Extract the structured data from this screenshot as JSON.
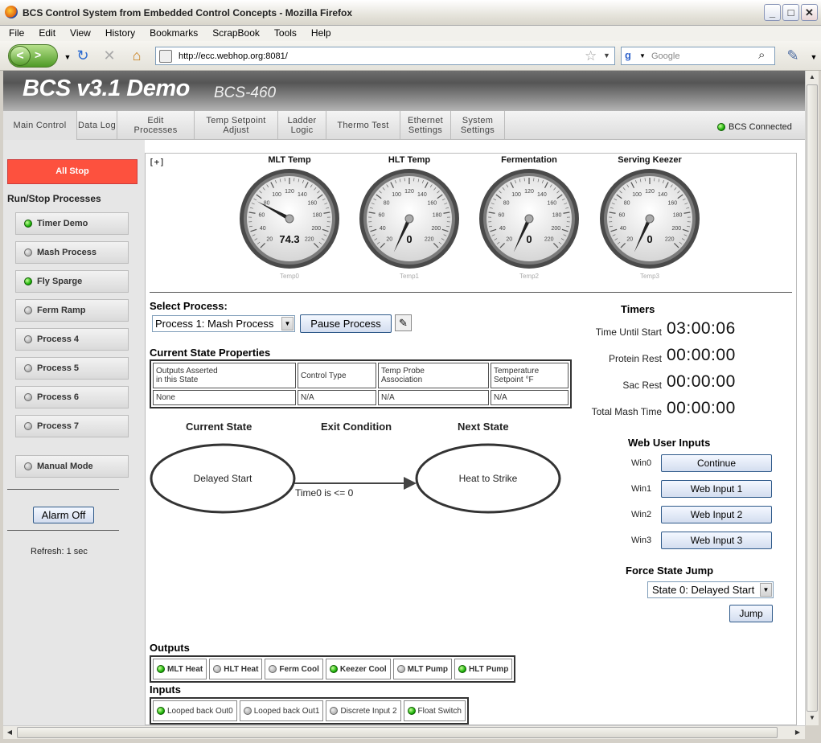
{
  "window": {
    "title": "BCS Control System from Embedded Control Concepts - Mozilla Firefox"
  },
  "menu": [
    "File",
    "Edit",
    "View",
    "History",
    "Bookmarks",
    "ScrapBook",
    "Tools",
    "Help"
  ],
  "browser": {
    "url": "http://ecc.webhop.org:8081/",
    "search_placeholder": "Google"
  },
  "header": {
    "title": "BCS v3.1 Demo",
    "model": "BCS-460"
  },
  "tabs": [
    {
      "label": "Main Control",
      "active": true
    },
    {
      "label": "Data Log"
    },
    {
      "label": "Edit\nProcesses"
    },
    {
      "label": "Temp Setpoint\nAdjust"
    },
    {
      "label": "Ladder\nLogic"
    },
    {
      "label": "Thermo Test"
    },
    {
      "label": "Ethernet\nSettings"
    },
    {
      "label": "System\nSettings"
    }
  ],
  "connection": {
    "label": "BCS Connected",
    "connected": true
  },
  "sidebar": {
    "all_stop": "All Stop",
    "run_stop_title": "Run/Stop Processes",
    "processes": [
      {
        "label": "Timer Demo",
        "on": true
      },
      {
        "label": "Mash Process",
        "on": false
      },
      {
        "label": "Fly Sparge",
        "on": true
      },
      {
        "label": "Ferm Ramp",
        "on": false
      },
      {
        "label": "Process 4",
        "on": false
      },
      {
        "label": "Process 5",
        "on": false
      },
      {
        "label": "Process 6",
        "on": false
      },
      {
        "label": "Process 7",
        "on": false
      }
    ],
    "manual_mode": {
      "label": "Manual Mode",
      "on": false
    },
    "alarm_off": "Alarm Off",
    "refresh": "Refresh: 1 sec"
  },
  "main": {
    "expand": "[+]",
    "gauges": [
      {
        "title": "MLT Temp",
        "value": 74.3,
        "display": "74.3",
        "sub": "Temp0"
      },
      {
        "title": "HLT Temp",
        "value": 0,
        "display": "0",
        "sub": "Temp1"
      },
      {
        "title": "Fermentation",
        "value": 0,
        "display": "0",
        "sub": "Temp2"
      },
      {
        "title": "Serving Keezer",
        "value": 0,
        "display": "0",
        "sub": "Temp3"
      }
    ],
    "gauge_scale": {
      "min": 20,
      "max": 220,
      "ticks": [
        "20",
        "40",
        "60",
        "80",
        "100",
        "120",
        "140",
        "160",
        "180",
        "200",
        "220"
      ]
    },
    "select_process_title": "Select Process:",
    "selected_process": "Process 1: Mash Process",
    "pause_button": "Pause Process",
    "current_state_title": "Current State Properties",
    "state_table": {
      "headers": [
        "Outputs Asserted\nin this State",
        "Control Type",
        "Temp Probe\nAssociation",
        "Temperature\nSetpoint °F"
      ],
      "row": [
        "None",
        "N/A",
        "N/A",
        "N/A"
      ]
    },
    "diagram": {
      "current_state_label": "Current State",
      "exit_condition_label": "Exit Condition",
      "next_state_label": "Next State",
      "current_state": "Delayed Start",
      "exit_condition": "Time0 is <= 0",
      "next_state": "Heat to Strike"
    },
    "timers_title": "Timers",
    "timers": [
      {
        "label": "Time Until Start",
        "value": "03:00:06"
      },
      {
        "label": "Protein Rest",
        "value": "00:00:00"
      },
      {
        "label": "Sac Rest",
        "value": "00:00:00"
      },
      {
        "label": "Total Mash Time",
        "value": "00:00:00"
      }
    ],
    "web_inputs_title": "Web User Inputs",
    "web_inputs": [
      {
        "id": "Win0",
        "label": "Continue"
      },
      {
        "id": "Win1",
        "label": "Web Input 1"
      },
      {
        "id": "Win2",
        "label": "Web Input 2"
      },
      {
        "id": "Win3",
        "label": "Web Input 3"
      }
    ],
    "force_jump_title": "Force State Jump",
    "jump_state": "State 0: Delayed Start",
    "jump_button": "Jump",
    "outputs_title": "Outputs",
    "outputs": [
      {
        "label": "MLT Heat",
        "on": true
      },
      {
        "label": "HLT Heat",
        "on": false
      },
      {
        "label": "Ferm Cool",
        "on": false
      },
      {
        "label": "Keezer Cool",
        "on": true
      },
      {
        "label": "MLT Pump",
        "on": false
      },
      {
        "label": "HLT Pump",
        "on": true
      }
    ],
    "inputs_title": "Inputs",
    "inputs": [
      {
        "label": "Looped back Out0",
        "on": true
      },
      {
        "label": "Looped back Out1",
        "on": false
      },
      {
        "label": "Discrete Input 2",
        "on": false
      },
      {
        "label": "Float Switch",
        "on": true
      }
    ]
  }
}
